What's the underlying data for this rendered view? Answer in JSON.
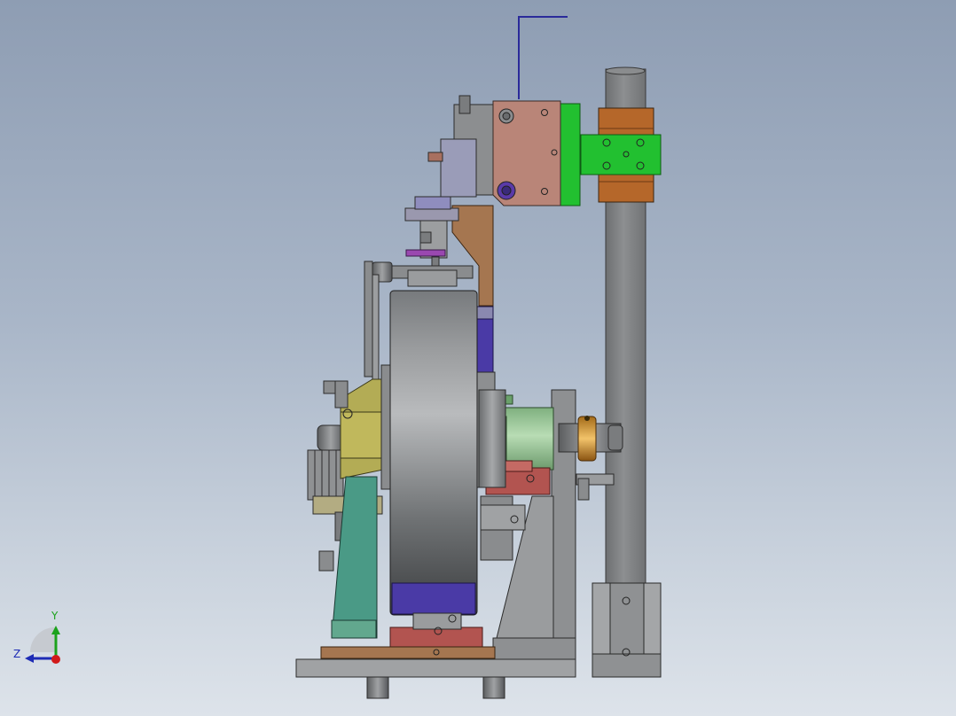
{
  "scene": {
    "background_top": "#8e9db3",
    "background_bottom": "#dde3ea",
    "model": "assembly-side-view"
  },
  "triad": {
    "y_label": "Y",
    "z_label": "Z",
    "y_color": "#1ca21c",
    "z_color": "#1d2bb5",
    "x_color": "#d11a1a"
  },
  "colors": {
    "wheel": "#8a8c8e",
    "frame": "#8b8c8e",
    "support_green": "#4a9a86",
    "bracket_green": "#22c030",
    "clamp_copper": "#b5672a",
    "plate_mauve": "#b98578",
    "brace_brown": "#a57650",
    "block_red": "#b25450",
    "block_purple": "#4a3aa6",
    "shaft_green": "#8fc08e",
    "yellow_body": "#b3ac55",
    "bearing_gold": "#d39a35",
    "wire_blue": "#2a2a9a"
  }
}
